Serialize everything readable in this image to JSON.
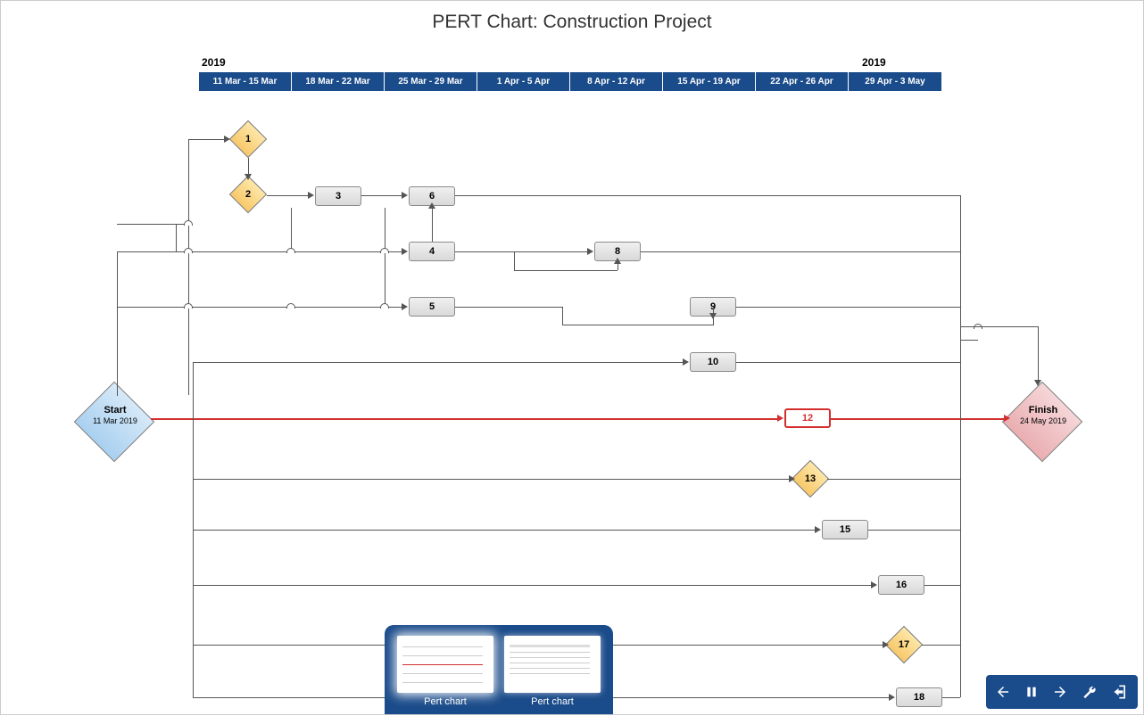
{
  "title": "PERT Chart: Construction Project",
  "years": {
    "left": "2019",
    "right": "2019"
  },
  "timeline": [
    "11 Mar - 15 Mar",
    "18 Mar - 22 Mar",
    "25 Mar - 29 Mar",
    "1 Apr - 5 Apr",
    "8 Apr - 12 Apr",
    "15 Apr - 19 Apr",
    "22 Apr - 26 Apr",
    "29 Apr - 3 May"
  ],
  "start": {
    "label": "Start",
    "date": "11 Mar 2019"
  },
  "finish": {
    "label": "Finish",
    "date": "24 May 2019"
  },
  "milestones": {
    "m1": "1",
    "m2": "2",
    "m13": "13",
    "m17": "17"
  },
  "tasks": {
    "t3": "3",
    "t4": "4",
    "t5": "5",
    "t6": "6",
    "t8": "8",
    "t9": "9",
    "t10": "10",
    "t12": "12",
    "t15": "15",
    "t16": "16",
    "t18": "18"
  },
  "thumbs": {
    "a": "Pert chart",
    "b": "Pert chart"
  },
  "toolbar": {
    "prev": "prev",
    "pause": "pause",
    "next": "next",
    "settings": "settings",
    "exit": "exit"
  }
}
